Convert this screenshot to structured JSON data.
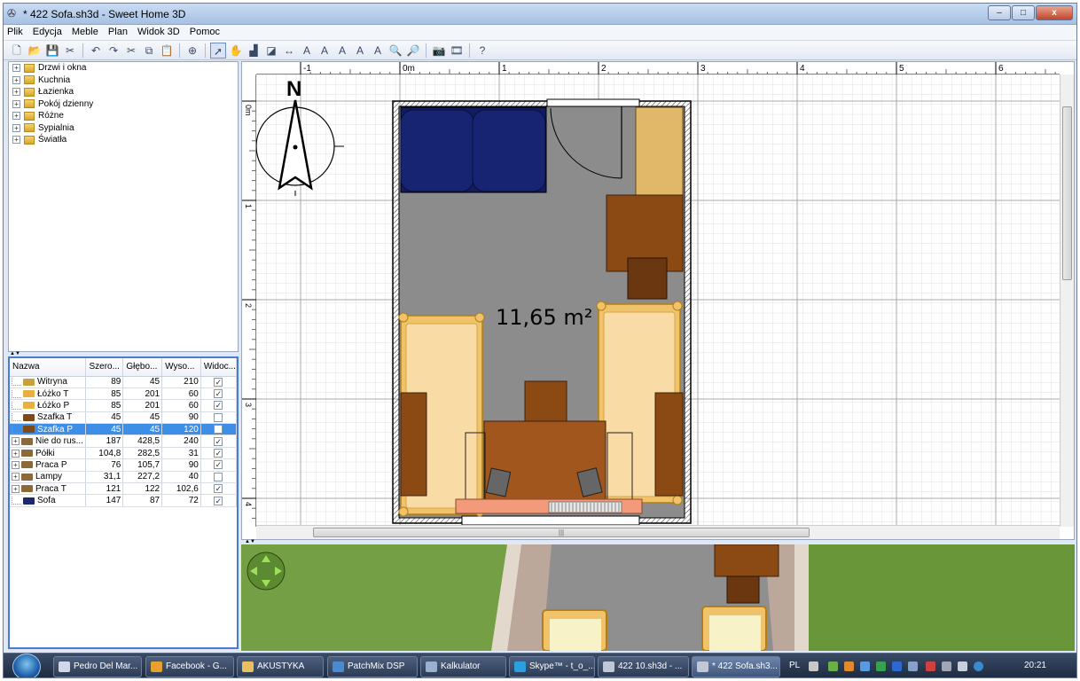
{
  "window": {
    "title": "* 422 Sofa.sh3d - Sweet Home 3D",
    "buttons": {
      "minimize": "–",
      "maximize": "□",
      "close": "x"
    }
  },
  "menu": [
    "Plik",
    "Edycja",
    "Meble",
    "Plan",
    "Widok 3D",
    "Pomoc"
  ],
  "toolbar_icons": [
    "new-file-icon",
    "open-icon",
    "save-icon",
    "cut-tool-icon",
    "undo-icon",
    "redo-icon",
    "cut-icon",
    "copy-icon",
    "paste-icon",
    "add-furniture-icon",
    "select-arrow-icon",
    "pan-hand-icon",
    "create-walls-icon",
    "create-rooms-icon",
    "create-dimensions-icon",
    "add-text-icon",
    "text-bold-icon",
    "text-italic-icon",
    "text-size-icon",
    "text-style-icon",
    "zoom-in-icon",
    "zoom-out-icon",
    "photo-icon",
    "video-icon",
    "help-icon"
  ],
  "catalog": {
    "categories": [
      "Drzwi i okna",
      "Kuchnia",
      "Łazienka",
      "Pokój dzienny",
      "Różne",
      "Sypialnia",
      "Światła"
    ]
  },
  "furniture_table": {
    "columns": [
      "Nazwa",
      "Szero...",
      "Głębo...",
      "Wyso...",
      "Widoc..."
    ],
    "rows": [
      {
        "name": "Witryna",
        "w": "89",
        "d": "45",
        "h": "210",
        "visible": true,
        "group": false,
        "selected": false,
        "color": "#c8a040"
      },
      {
        "name": "Łóżko T",
        "w": "85",
        "d": "201",
        "h": "60",
        "visible": true,
        "group": false,
        "selected": false,
        "color": "#e8b040"
      },
      {
        "name": "Łóżko P",
        "w": "85",
        "d": "201",
        "h": "60",
        "visible": true,
        "group": false,
        "selected": false,
        "color": "#e8b040"
      },
      {
        "name": "Szafka T",
        "w": "45",
        "d": "45",
        "h": "90",
        "visible": false,
        "group": false,
        "selected": false,
        "color": "#7a4a1a"
      },
      {
        "name": "Szafka P",
        "w": "45",
        "d": "45",
        "h": "120",
        "visible": false,
        "group": false,
        "selected": true,
        "color": "#7a4a1a"
      },
      {
        "name": "Nie do rus...",
        "w": "187",
        "d": "428,5",
        "h": "240",
        "visible": true,
        "group": true,
        "selected": false,
        "color": "#8a6a3a"
      },
      {
        "name": "Półki",
        "w": "104,8",
        "d": "282,5",
        "h": "31",
        "visible": true,
        "group": true,
        "selected": false,
        "color": "#8a6a3a"
      },
      {
        "name": "Praca P",
        "w": "76",
        "d": "105,7",
        "h": "90",
        "visible": true,
        "group": true,
        "selected": false,
        "color": "#8a6a3a"
      },
      {
        "name": "Lampy",
        "w": "31,1",
        "d": "227,2",
        "h": "40",
        "visible": false,
        "group": true,
        "selected": false,
        "color": "#8a6a3a"
      },
      {
        "name": "Praca T",
        "w": "121",
        "d": "122",
        "h": "102,6",
        "visible": true,
        "group": true,
        "selected": false,
        "color": "#8a6a3a"
      },
      {
        "name": "Sofa",
        "w": "147",
        "d": "87",
        "h": "72",
        "visible": true,
        "group": false,
        "selected": false,
        "color": "#1a2a6a"
      }
    ]
  },
  "plan": {
    "ruler_labels": [
      "-1",
      "0m",
      "1",
      "2",
      "3",
      "4",
      "5",
      "6"
    ],
    "vruler_labels": [
      "0m",
      "1",
      "2",
      "3",
      "4"
    ],
    "room_area": "11,65 m²",
    "compass_label": "N",
    "colors": {
      "floor": "#8c8c8c",
      "sofa": "#121c5e",
      "bed": "#f0c36a",
      "bed_inner": "#f9dca5",
      "wood": "#8b4a14",
      "wood_light": "#a0561c",
      "cabinet": "#e1b86a",
      "desk_strip": "#f39a7a"
    }
  },
  "taskbar": {
    "tasks": [
      {
        "label": "Pedro Del Mar...",
        "active": false,
        "icon_color": "#d0d8e8"
      },
      {
        "label": "Facebook - G...",
        "active": false,
        "icon_color": "#e8a030"
      },
      {
        "label": "AKUSTYKA",
        "active": false,
        "icon_color": "#e8c060"
      },
      {
        "label": "PatchMix DSP",
        "active": false,
        "icon_color": "#4a8ad0"
      },
      {
        "label": "Kalkulator",
        "active": false,
        "icon_color": "#9ab0d0"
      },
      {
        "label": "Skype™ - t_o_...",
        "active": false,
        "icon_color": "#2aa0e0"
      },
      {
        "label": "422 10.sh3d - ...",
        "active": false,
        "icon_color": "#c0c8d8"
      },
      {
        "label": "* 422 Sofa.sh3...",
        "active": true,
        "icon_color": "#c0c8d8"
      }
    ],
    "language": "PL",
    "clock": "20:21"
  }
}
